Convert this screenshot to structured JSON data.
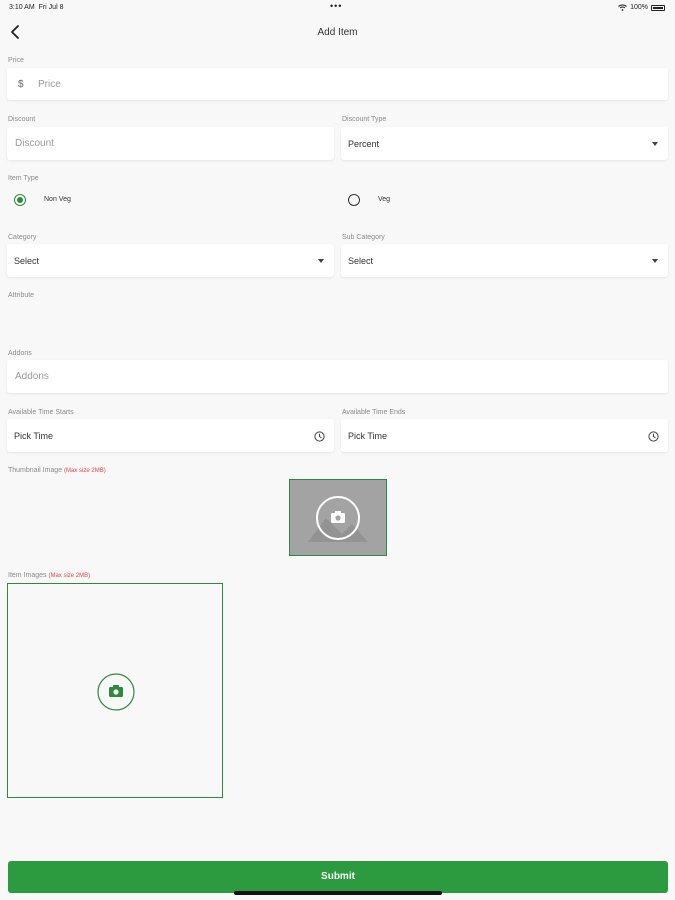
{
  "status_bar": {
    "time": "3:10 AM",
    "date": "Fri Jul 8",
    "battery": "100%"
  },
  "header": {
    "title": "Add Item"
  },
  "price": {
    "label": "Price",
    "currency_symbol": "$",
    "placeholder": "Price"
  },
  "discount": {
    "label": "Discount",
    "placeholder": "Discount"
  },
  "discount_type": {
    "label": "Discount Type",
    "value": "Percent"
  },
  "item_type": {
    "label": "Item Type",
    "options": [
      "Non Veg",
      "Veg"
    ],
    "selected": "Non Veg"
  },
  "category": {
    "label": "Category",
    "value": "Select"
  },
  "sub_category": {
    "label": "Sub Category",
    "value": "Select"
  },
  "attribute": {
    "label": "Attribute"
  },
  "addons": {
    "label": "Addons",
    "placeholder": "Addons"
  },
  "time_starts": {
    "label": "Available Time Starts",
    "value": "Pick Time"
  },
  "time_ends": {
    "label": "Available Time Ends",
    "value": "Pick Time"
  },
  "thumbnail": {
    "label": "Thumbnail Image",
    "note": "(Max size 2MB)"
  },
  "item_images": {
    "label": "Item Images",
    "note": "(Max size 2MB)"
  },
  "submit": {
    "label": "Submit"
  },
  "colors": {
    "accent": "#2c9a3e",
    "required": "#e04848",
    "background": "#f8f8f8"
  },
  "icons": [
    "back-arrow-icon",
    "wifi-icon",
    "battery-icon",
    "caret-down-icon",
    "clock-icon",
    "camera-icon"
  ]
}
